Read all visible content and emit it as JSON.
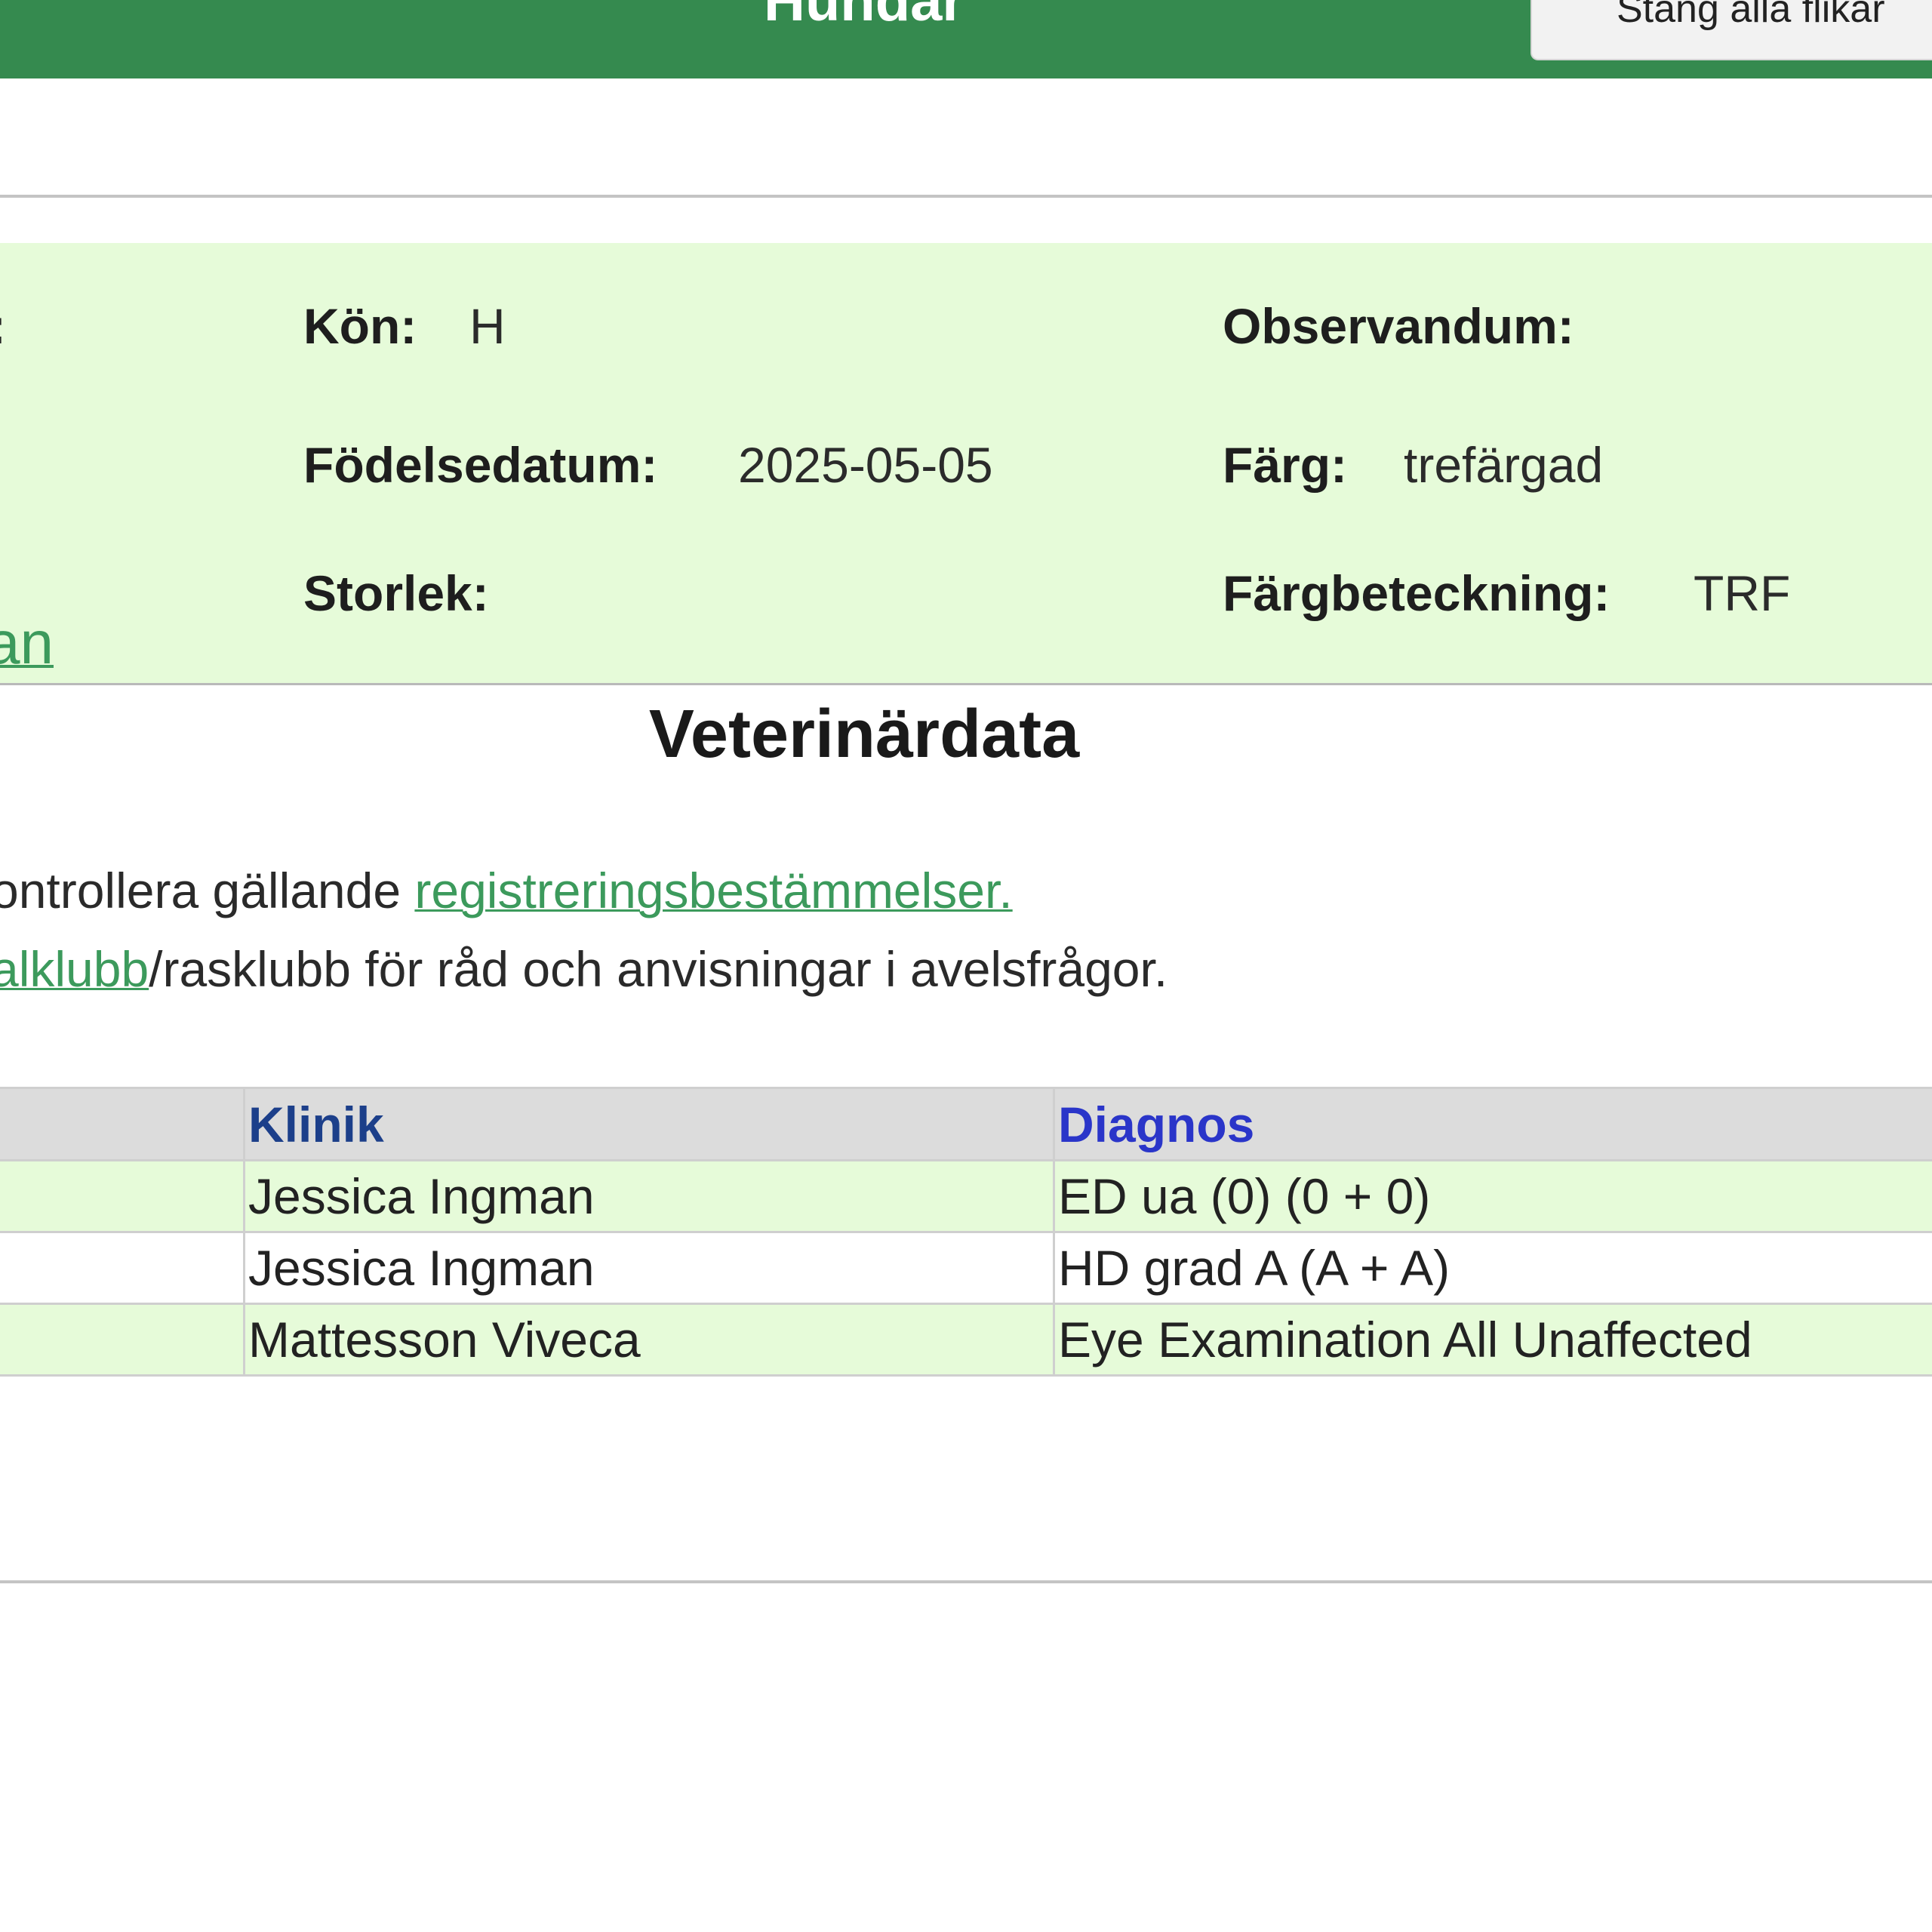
{
  "header": {
    "title": "Hundar",
    "close_tabs_label": "Stäng alla flikar",
    "background_color": "#358a4f"
  },
  "dog_info": {
    "sex_label": "Kön:",
    "sex_value": "H",
    "observandum_label": "Observandum:",
    "birthdate_label": "Födelsedatum:",
    "birthdate_value": "2025-05-05",
    "color_label": "Färg:",
    "color_value": "trefärgad",
    "size_label": "Storlek:",
    "color_code_label": "Färgbeteckning:",
    "color_code_value": "TRF",
    "partial_colon": ":",
    "partial_link": "an"
  },
  "vet_section": {
    "title": "Veterinärdata",
    "notice1_prefix": "ontrollera gällande ",
    "notice1_link": "registreringsbestämmelser.",
    "notice2_link": "alklubb",
    "notice2_suffix": "/rasklubb för råd och anvisningar i avelsfrågor."
  },
  "vet_table": {
    "columns": [
      "",
      "Klinik",
      "Diagnos"
    ],
    "rows": [
      {
        "klinik": "Jessica Ingman",
        "diagnos": "ED ua (0) (0 + 0)"
      },
      {
        "klinik": "Jessica Ingman",
        "diagnos": "HD grad A (A + A)"
      },
      {
        "klinik": "Mattesson Viveca",
        "diagnos": "Eye Examination All Unaffected"
      }
    ]
  },
  "colors": {
    "panel_bg": "#e6fbd9",
    "link": "#3c9a5c",
    "header_text_klinik": "#1c3f8a",
    "header_text_diagnos": "#2a35c9"
  }
}
